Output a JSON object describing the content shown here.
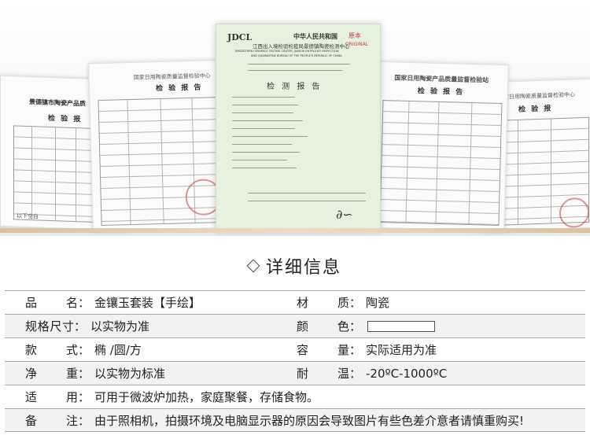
{
  "certificates": {
    "left_doc": {
      "title": "景德镇市陶瓷产品质",
      "subtitle": "检 验 报",
      "footer": "以下空白"
    },
    "left2_doc": {
      "header": "国家日用陶瓷质量监督检验中心",
      "title": "检 验 报 告"
    },
    "center_doc": {
      "logo": "JDCL",
      "header1": "中华人民共和国",
      "header2": "江西出入境检验检疫局景德镇陶瓷检测中心",
      "header3": "JINGDEZHEN CERAMICS TESTING CENTER, JIANGXI ENTRY-EXIT INSPECTION",
      "header4": "AND QUARANTINE BUREAU OF THE PEOPLE'S REPUBLIC OF CHINA",
      "stamp_text": "原本",
      "stamp_sub": "ORIGINAL",
      "title": "检 测 报 告"
    },
    "right2_doc": {
      "header": "国家日用陶瓷产品质量监督检验站",
      "title": "检 验 报 告"
    },
    "right_doc": {
      "header": "国家日用陶瓷质量监督检验中心",
      "title": "检 验 报"
    }
  },
  "section": {
    "title": "详细信息",
    "icon": "diamond-icon"
  },
  "details": [
    {
      "left": {
        "label": "品名",
        "value": "金镶玉套装【手绘】"
      },
      "right": {
        "label": "材质",
        "value": "陶瓷"
      }
    },
    {
      "left": {
        "label": "规格尺寸",
        "value": "以实物为准"
      },
      "right": {
        "label": "颜色",
        "value": "",
        "swatch_color": "#ffffff"
      }
    },
    {
      "left": {
        "label": "款式",
        "value": "椭 /圆/方"
      },
      "right": {
        "label": "容量",
        "value": "实际适用为准"
      }
    },
    {
      "left": {
        "label": "净重",
        "value": "以实物为标准"
      },
      "right": {
        "label": "耐温",
        "value": "-20ºC-1000ºC"
      }
    },
    {
      "full": {
        "label": "适用",
        "value": "可用于微波炉加热，家庭聚餐，存储食物。"
      }
    },
    {
      "full": {
        "label": "备注",
        "value": "由于照相机，拍摄环境及电脑显示器的原因会导致图片有些色差介意者请慎重购买!"
      }
    }
  ],
  "separator": "："
}
